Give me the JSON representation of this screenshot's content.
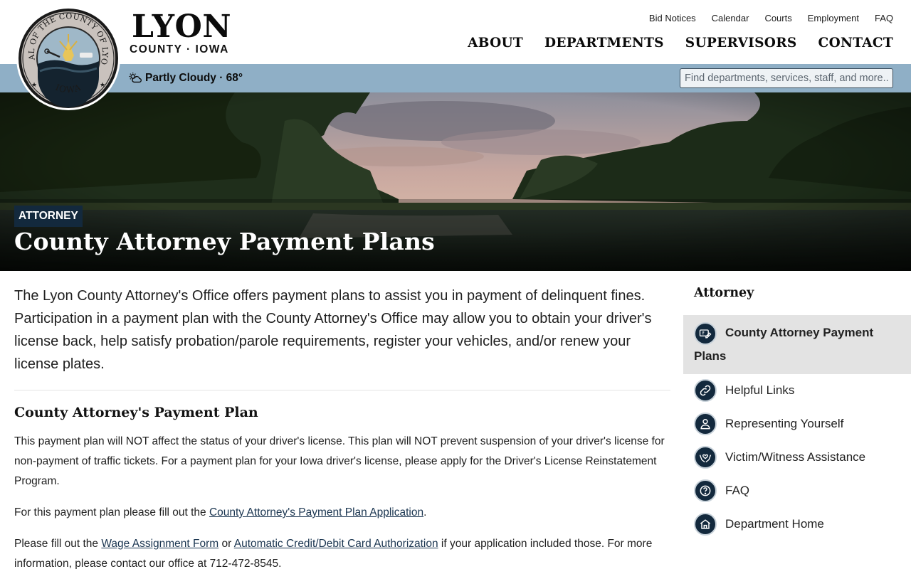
{
  "brand": {
    "name": "LYON",
    "subtitle": "COUNTY · IOWA",
    "seal_top": "SEAL OF THE COUNTY OF LYON",
    "seal_bottom": "IOWA"
  },
  "utility_nav": [
    "Bid Notices",
    "Calendar",
    "Courts",
    "Employment",
    "FAQ"
  ],
  "main_nav": [
    "ABOUT",
    "DEPARTMENTS",
    "SUPERVISORS",
    "CONTACT"
  ],
  "weather": {
    "text": "Partly Cloudy · 68°",
    "icon": "partly-cloudy-icon"
  },
  "search": {
    "placeholder": "Find departments, services, staff, and more..",
    "value": ""
  },
  "hero": {
    "breadcrumb": "ATTORNEY",
    "title": "County Attorney Payment Plans"
  },
  "content": {
    "intro": "The Lyon County Attorney's Office offers payment plans to assist you in payment of delinquent fines. Participation in a payment plan with the County Attorney's Office may allow you to obtain your driver's license back, help satisfy probation/parole requirements, register your vehicles, and/or renew your license plates.",
    "section_heading": "County Attorney's Payment Plan",
    "p1": "This payment plan will NOT affect the status of your driver's license. This plan will NOT prevent suspension of your driver's license for non-payment of traffic tickets. For a payment plan for your Iowa driver's license, please apply for the Driver's License Reinstatement Program.",
    "p2_before": "For this payment plan please fill out the ",
    "p2_link": "County Attorney's Payment Plan Application",
    "p2_after": ".",
    "p3_before": "Please fill out the ",
    "p3_link1": "Wage Assignment Form",
    "p3_mid": " or ",
    "p3_link2": "Automatic Credit/Debit Card Authorization",
    "p3_after": " if your application included those. For more information, please contact our office at 712-472-8545."
  },
  "sidebar": {
    "title": "Attorney",
    "active": {
      "label": "County Attorney Payment Plans",
      "icon": "payment-icon"
    },
    "items": [
      {
        "label": "Helpful Links",
        "icon": "link-icon"
      },
      {
        "label": "Representing Yourself",
        "icon": "person-icon"
      },
      {
        "label": "Victim/Witness Assistance",
        "icon": "helping-hands-icon"
      },
      {
        "label": "FAQ",
        "icon": "question-icon"
      },
      {
        "label": "Department Home",
        "icon": "home-icon"
      }
    ]
  },
  "colors": {
    "navy": "#13293d",
    "bar": "#8fafc6",
    "active_bg": "#e3e3e3"
  }
}
